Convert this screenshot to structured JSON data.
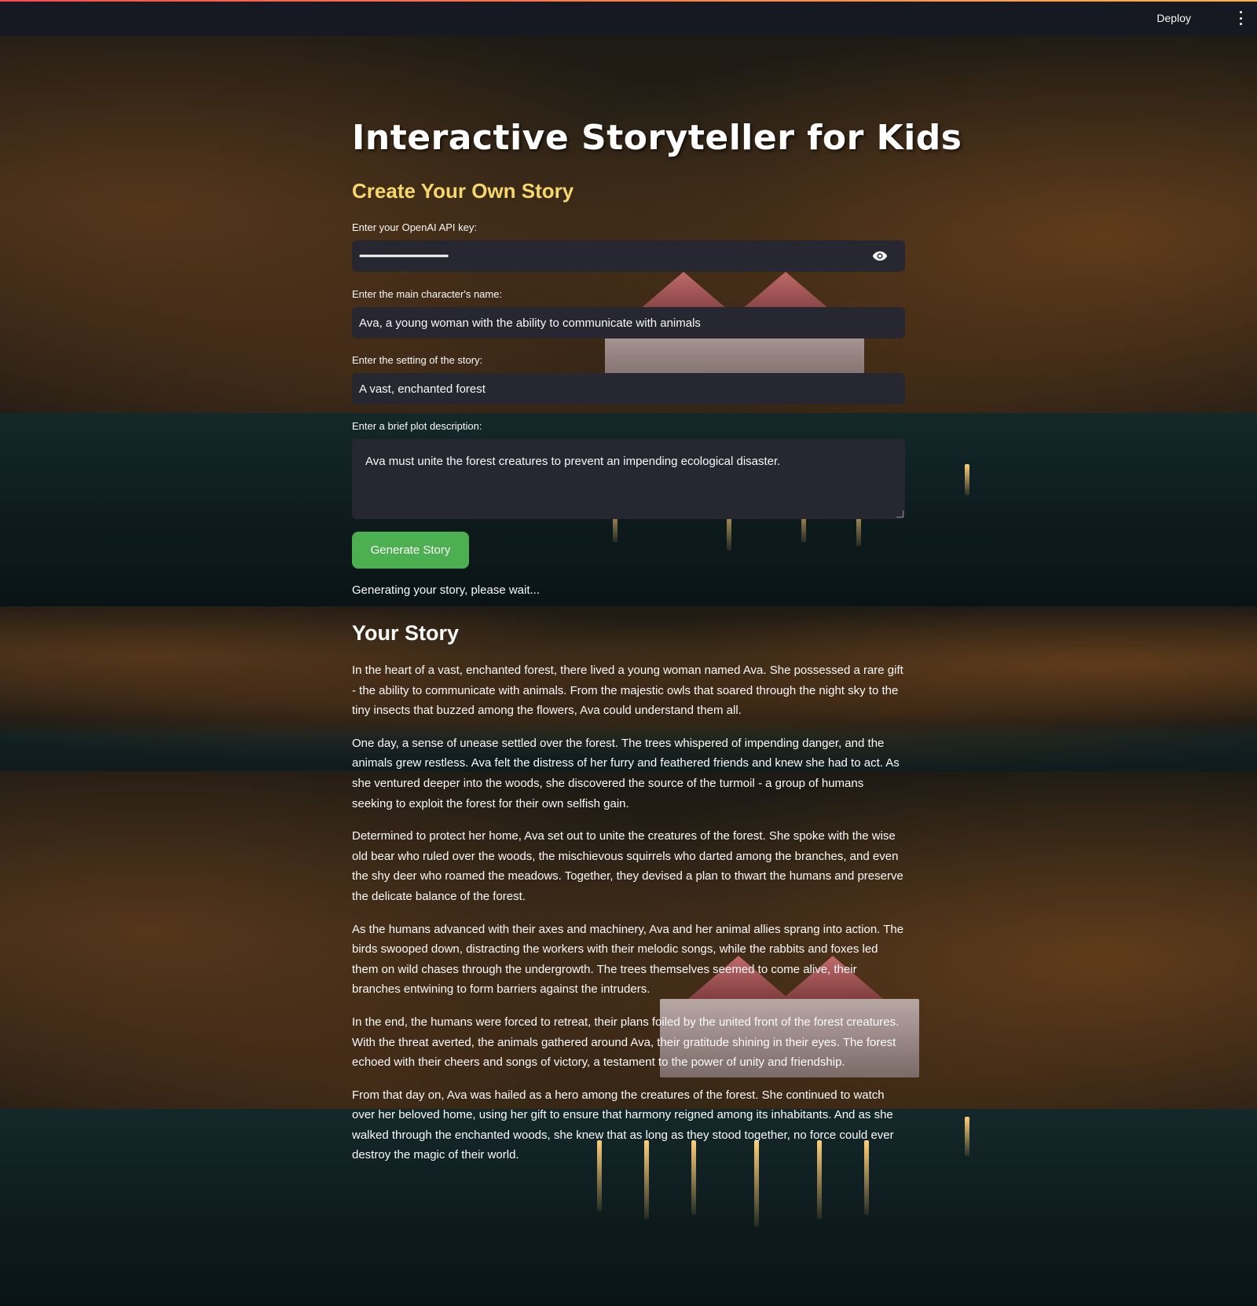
{
  "header": {
    "deploy_label": "Deploy"
  },
  "main": {
    "title": "Interactive Storyteller for Kids",
    "subtitle": "Create Your Own Story",
    "api_key": {
      "label": "Enter your OpenAI API key:",
      "value": "•••••••••••••••••••••••••••••••••••••••••••••••••••"
    },
    "character": {
      "label": "Enter the main character's name:",
      "value": "Ava, a young woman with the ability to communicate with animals"
    },
    "setting": {
      "label": "Enter the setting of the story:",
      "value": "A vast, enchanted forest"
    },
    "plot": {
      "label": "Enter a brief plot description:",
      "value": "Ava must unite the forest creatures to prevent an impending ecological disaster."
    },
    "generate_button": "Generate Story",
    "status": "Generating your story, please wait...",
    "story_heading": "Your Story",
    "story_paragraphs": [
      "In the heart of a vast, enchanted forest, there lived a young woman named Ava. She possessed a rare gift - the ability to communicate with animals. From the majestic owls that soared through the night sky to the tiny insects that buzzed among the flowers, Ava could understand them all.",
      "One day, a sense of unease settled over the forest. The trees whispered of impending danger, and the animals grew restless. Ava felt the distress of her furry and feathered friends and knew she had to act. As she ventured deeper into the woods, she discovered the source of the turmoil - a group of humans seeking to exploit the forest for their own selfish gain.",
      "Determined to protect her home, Ava set out to unite the creatures of the forest. She spoke with the wise old bear who ruled over the woods, the mischievous squirrels who darted among the branches, and even the shy deer who roamed the meadows. Together, they devised a plan to thwart the humans and preserve the delicate balance of the forest.",
      "As the humans advanced with their axes and machinery, Ava and her animal allies sprang into action. The birds swooped down, distracting the workers with their melodic songs, while the rabbits and foxes led them on wild chases through the undergrowth. The trees themselves seemed to come alive, their branches entwining to form barriers against the intruders.",
      "In the end, the humans were forced to retreat, their plans foiled by the united front of the forest creatures. With the threat averted, the animals gathered around Ava, their gratitude shining in their eyes. The forest echoed with their cheers and songs of victory, a testament to the power of unity and friendship.",
      "From that day on, Ava was hailed as a hero among the creatures of the forest. She continued to watch over her beloved home, using her gift to ensure that harmony reigned among its inhabitants. And as she walked through the enchanted woods, she knew that as long as they stood together, no force could ever destroy the magic of their world."
    ]
  },
  "colors": {
    "accent_button": "#4caf50",
    "subtitle": "#f5d76e",
    "input_bg": "#262730",
    "topbar_bg": "#161922"
  },
  "icons": {
    "password_toggle": "eye-icon",
    "menu": "kebab-menu-icon"
  }
}
